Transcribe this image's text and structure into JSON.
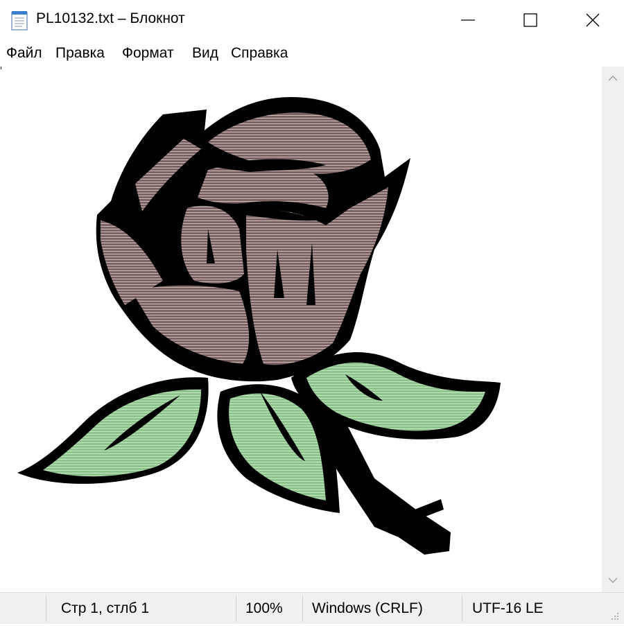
{
  "window": {
    "title": "PL10132.txt – Блокнот",
    "icon": "notepad-icon",
    "controls": [
      "minimize-icon",
      "maximize-icon",
      "close-icon"
    ]
  },
  "menu": {
    "file": "Файл",
    "edit": "Правка",
    "format": "Формат",
    "view": "Вид",
    "help": "Справка"
  },
  "document": {
    "content_image": "rose-bud-ascii-art",
    "colors": {
      "petal": "#7a6565",
      "leaf": "#9ccf9c",
      "outline": "#000000"
    }
  },
  "status": {
    "position": "Стр 1, стлб 1",
    "zoom": "100%",
    "line_endings": "Windows (CRLF)",
    "encoding": "UTF-16 LE"
  }
}
